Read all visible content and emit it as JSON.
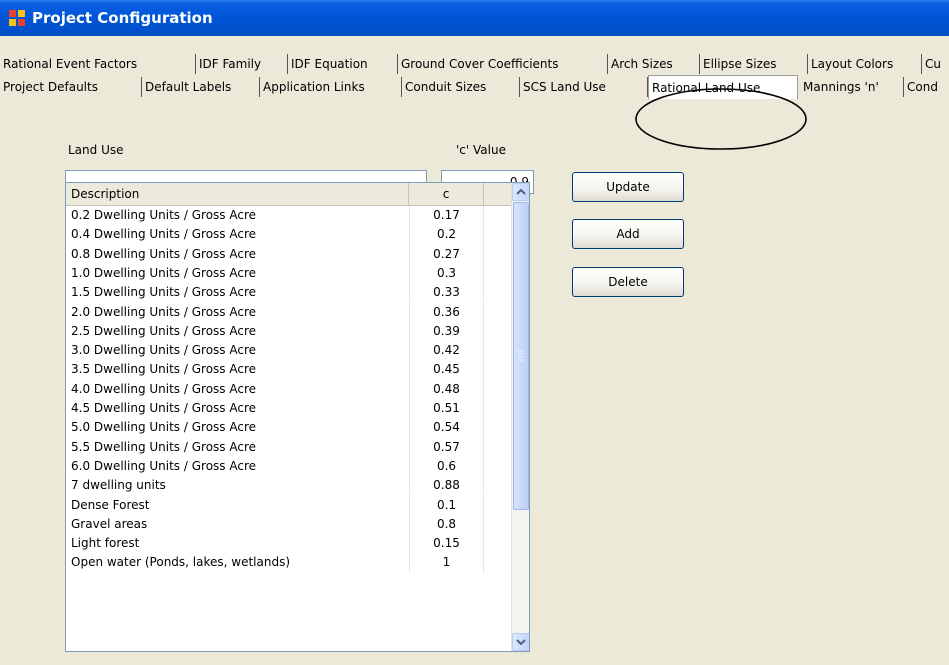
{
  "window": {
    "title": "Project Configuration"
  },
  "tabs_row1": [
    "Rational Event Factors",
    "IDF Family",
    "IDF Equation",
    "Ground Cover Coefficients",
    "Arch Sizes",
    "Ellipse Sizes",
    "Layout Colors",
    "Cu"
  ],
  "tabs_row2": [
    "Project Defaults",
    "Default Labels",
    "Application Links",
    "Conduit Sizes",
    "SCS Land Use",
    "Rational Land Use",
    "Mannings 'n'",
    "Cond"
  ],
  "active_tab": "Rational Land Use",
  "form": {
    "land_use_label": "Land Use",
    "land_use_value": "",
    "c_value_label": "'c' Value",
    "c_value": "0.9"
  },
  "buttons": {
    "update": "Update",
    "add": "Add",
    "delete": "Delete"
  },
  "grid": {
    "columns": [
      "Description",
      "c"
    ],
    "rows": [
      [
        "0.2 Dwelling Units / Gross Acre",
        "0.17"
      ],
      [
        "0.4 Dwelling Units / Gross Acre",
        "0.2"
      ],
      [
        "0.8 Dwelling Units / Gross Acre",
        "0.27"
      ],
      [
        "1.0 Dwelling Units / Gross Acre",
        "0.3"
      ],
      [
        "1.5 Dwelling Units / Gross Acre",
        "0.33"
      ],
      [
        "2.0 Dwelling Units / Gross Acre",
        "0.36"
      ],
      [
        "2.5 Dwelling Units / Gross Acre",
        "0.39"
      ],
      [
        "3.0 Dwelling Units / Gross Acre",
        "0.42"
      ],
      [
        "3.5 Dwelling Units / Gross Acre",
        "0.45"
      ],
      [
        "4.0 Dwelling Units / Gross Acre",
        "0.48"
      ],
      [
        "4.5 Dwelling Units / Gross Acre",
        "0.51"
      ],
      [
        "5.0 Dwelling Units / Gross Acre",
        "0.54"
      ],
      [
        "5.5 Dwelling Units / Gross Acre",
        "0.57"
      ],
      [
        "6.0 Dwelling Units / Gross Acre",
        "0.6"
      ],
      [
        "7 dwelling units",
        "0.88"
      ],
      [
        "Dense Forest",
        "0.1"
      ],
      [
        "Gravel areas",
        "0.8"
      ],
      [
        "Light forest",
        "0.15"
      ],
      [
        "Open water (Ponds, lakes, wetlands)",
        "1"
      ]
    ]
  },
  "colors": {
    "titlebar": "#0054e3",
    "dialog_bg": "#ece9d8",
    "scrollbar": "#c1d4f8"
  }
}
